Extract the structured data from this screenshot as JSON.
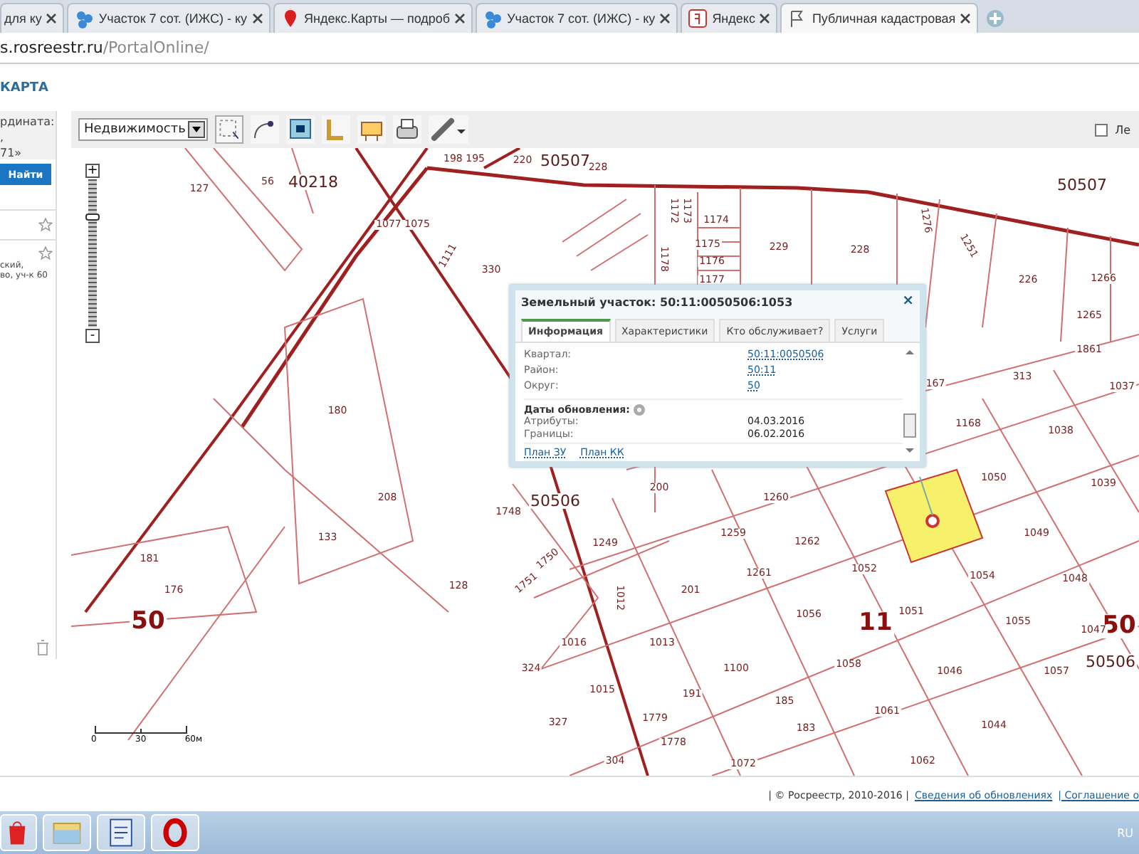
{
  "browser": {
    "tabs": [
      {
        "title": "для ку",
        "selected": false
      },
      {
        "title": "Участок 7 сот. (ИЖС) - ку",
        "selected": false
      },
      {
        "title": "Яндекс.Карты — подроб",
        "selected": false
      },
      {
        "title": "Участок 7 сот. (ИЖС) - ку",
        "selected": false
      },
      {
        "title": "Яндекс",
        "selected": false
      },
      {
        "title": "Публичная кадастровая",
        "selected": true
      }
    ],
    "address": {
      "host": "s.rosreestr.ru",
      "path": "/PortalOnline/"
    }
  },
  "header": {
    "title": "КАРТА"
  },
  "left_panel": {
    "lines": [
      "рдината:",
      ",",
      "71»"
    ],
    "search_button": "Найти",
    "result_lines": [
      "ский,",
      "во, уч-к 60"
    ]
  },
  "toolbar": {
    "layer_select": "Недвижимость",
    "checkbox": {
      "label": "Ле",
      "checked": false
    }
  },
  "map": {
    "zoom": {
      "plus": "+",
      "minus": "-",
      "level": 0.77
    },
    "labels": [
      {
        "text": "127",
        "kind": "parcel"
      },
      {
        "text": "56",
        "kind": "parcel"
      },
      {
        "text": "40218",
        "kind": "block"
      },
      {
        "text": "198 195",
        "kind": "parcel"
      },
      {
        "text": "220",
        "kind": "parcel"
      },
      {
        "text": "50507",
        "kind": "block"
      },
      {
        "text": "228",
        "kind": "parcel"
      },
      {
        "text": "50507",
        "kind": "block"
      },
      {
        "text": "1077 1075",
        "kind": "parcel"
      },
      {
        "text": "1111",
        "kind": "parcel"
      },
      {
        "text": "330",
        "kind": "parcel"
      },
      {
        "text": "1172",
        "kind": "parcel"
      },
      {
        "text": "1173",
        "kind": "parcel"
      },
      {
        "text": "1174",
        "kind": "parcel"
      },
      {
        "text": "1175",
        "kind": "parcel"
      },
      {
        "text": "1176",
        "kind": "parcel"
      },
      {
        "text": "1177",
        "kind": "parcel"
      },
      {
        "text": "1178",
        "kind": "parcel"
      },
      {
        "text": "229",
        "kind": "parcel"
      },
      {
        "text": "228",
        "kind": "parcel"
      },
      {
        "text": "1276",
        "kind": "parcel"
      },
      {
        "text": "1251",
        "kind": "parcel"
      },
      {
        "text": "226",
        "kind": "parcel"
      },
      {
        "text": "1266",
        "kind": "parcel"
      },
      {
        "text": "1265",
        "kind": "parcel"
      },
      {
        "text": "1861",
        "kind": "parcel"
      },
      {
        "text": "1037",
        "kind": "parcel"
      },
      {
        "text": "313",
        "kind": "parcel"
      },
      {
        "text": "167",
        "kind": "parcel"
      },
      {
        "text": "1168",
        "kind": "parcel"
      },
      {
        "text": "1038",
        "kind": "parcel"
      },
      {
        "text": "1050",
        "kind": "parcel"
      },
      {
        "text": "1039",
        "kind": "parcel"
      },
      {
        "text": "180",
        "kind": "parcel"
      },
      {
        "text": "208",
        "kind": "parcel"
      },
      {
        "text": "1748",
        "kind": "parcel"
      },
      {
        "text": "50506",
        "kind": "block"
      },
      {
        "text": "200",
        "kind": "parcel"
      },
      {
        "text": "1260",
        "kind": "parcel"
      },
      {
        "text": "1259",
        "kind": "parcel"
      },
      {
        "text": "1249",
        "kind": "parcel"
      },
      {
        "text": "1262",
        "kind": "parcel"
      },
      {
        "text": "1750",
        "kind": "parcel"
      },
      {
        "text": "1751",
        "kind": "parcel"
      },
      {
        "text": "1261",
        "kind": "parcel"
      },
      {
        "text": "201",
        "kind": "parcel"
      },
      {
        "text": "1052",
        "kind": "parcel"
      },
      {
        "text": "1054",
        "kind": "parcel"
      },
      {
        "text": "1049",
        "kind": "parcel"
      },
      {
        "text": "1048",
        "kind": "parcel"
      },
      {
        "text": "181",
        "kind": "parcel"
      },
      {
        "text": "176",
        "kind": "parcel"
      },
      {
        "text": "133",
        "kind": "parcel"
      },
      {
        "text": "128",
        "kind": "parcel"
      },
      {
        "text": "50",
        "kind": "zone"
      },
      {
        "text": "11",
        "kind": "zone"
      },
      {
        "text": "50",
        "kind": "zone"
      },
      {
        "text": "1056",
        "kind": "parcel"
      },
      {
        "text": "1051",
        "kind": "parcel"
      },
      {
        "text": "1055",
        "kind": "parcel"
      },
      {
        "text": "1047",
        "kind": "parcel"
      },
      {
        "text": "1016",
        "kind": "parcel"
      },
      {
        "text": "1013",
        "kind": "parcel"
      },
      {
        "text": "1012",
        "kind": "parcel"
      },
      {
        "text": "324",
        "kind": "parcel"
      },
      {
        "text": "1015",
        "kind": "parcel"
      },
      {
        "text": "327",
        "kind": "parcel"
      },
      {
        "text": "1100",
        "kind": "parcel"
      },
      {
        "text": "1058",
        "kind": "parcel"
      },
      {
        "text": "1046",
        "kind": "parcel"
      },
      {
        "text": "1057",
        "kind": "parcel"
      },
      {
        "text": "50506",
        "kind": "block"
      },
      {
        "text": "185",
        "kind": "parcel"
      },
      {
        "text": "191",
        "kind": "parcel"
      },
      {
        "text": "183",
        "kind": "parcel"
      },
      {
        "text": "1061",
        "kind": "parcel"
      },
      {
        "text": "1044",
        "kind": "parcel"
      },
      {
        "text": "304",
        "kind": "parcel"
      },
      {
        "text": "1072",
        "kind": "parcel"
      },
      {
        "text": "1062",
        "kind": "parcel"
      },
      {
        "text": "1779",
        "kind": "parcel"
      },
      {
        "text": "1778",
        "kind": "parcel"
      }
    ],
    "scale": [
      "0",
      "30",
      "60м"
    ],
    "popup": {
      "title": "Земельный участок: 50:11:0050506:1053",
      "close": "×",
      "tabs": [
        {
          "label": "Информация",
          "selected": true
        },
        {
          "label": "Характеристики",
          "selected": false
        },
        {
          "label": "Кто обслуживает?",
          "selected": false
        },
        {
          "label": "Услуги",
          "selected": false
        }
      ],
      "fields": [
        {
          "label": "Квартал:",
          "value": "50:11:0050506"
        },
        {
          "label": "Район:",
          "value": "50:11"
        },
        {
          "label": "Округ:",
          "value": "50"
        }
      ],
      "dates_heading": "Даты обновления:",
      "dates": [
        {
          "label": "Атрибуты:",
          "value": "04.03.2016"
        },
        {
          "label": "Границы:",
          "value": "06.02.2016"
        }
      ],
      "links": [
        "План ЗУ",
        "План КК"
      ]
    }
  },
  "footer": {
    "copyright": "| © Росреестр, 2010-2016 |",
    "links": [
      "Сведения об обновлениях",
      "| Соглашение о"
    ]
  },
  "taskbar": {
    "language": "RU"
  }
}
